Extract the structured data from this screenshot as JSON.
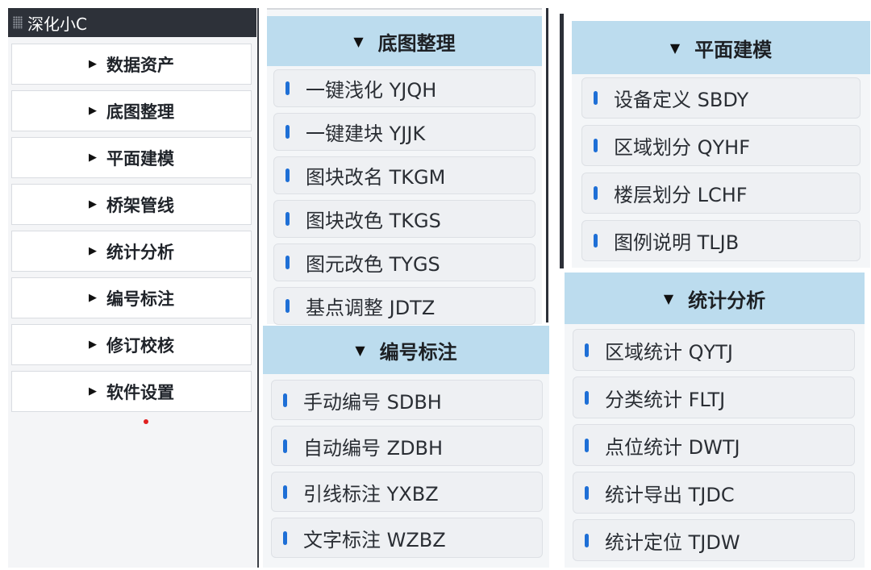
{
  "window": {
    "title": "深化小C"
  },
  "main_menu": [
    {
      "label": "数据资产"
    },
    {
      "label": "底图整理"
    },
    {
      "label": "平面建模"
    },
    {
      "label": "桥架管线"
    },
    {
      "label": "统计分析"
    },
    {
      "label": "编号标注"
    },
    {
      "label": "修订校核"
    },
    {
      "label": "软件设置"
    }
  ],
  "panels": {
    "ditu": {
      "title": "底图整理",
      "items": [
        {
          "label": "一键浅化 YJQH"
        },
        {
          "label": "一键建块 YJJK"
        },
        {
          "label": "图块改名 TKGM"
        },
        {
          "label": "图块改色 TKGS"
        },
        {
          "label": "图元改色 TYGS"
        },
        {
          "label": "基点调整 JDTZ"
        }
      ]
    },
    "pingmian": {
      "title": "平面建模",
      "items": [
        {
          "label": "设备定义 SBDY"
        },
        {
          "label": "区域划分 QYHF"
        },
        {
          "label": "楼层划分 LCHF"
        },
        {
          "label": "图例说明 TLJB"
        }
      ]
    },
    "bianhao": {
      "title": "编号标注",
      "items": [
        {
          "label": "手动编号 SDBH"
        },
        {
          "label": "自动编号 ZDBH"
        },
        {
          "label": "引线标注 YXBZ"
        },
        {
          "label": "文字标注 WZBZ"
        }
      ]
    },
    "tongji": {
      "title": "统计分析",
      "items": [
        {
          "label": "区域统计 QYTJ"
        },
        {
          "label": "分类统计 FLTJ"
        },
        {
          "label": "点位统计 DWTJ"
        },
        {
          "label": "统计导出 TJDC"
        },
        {
          "label": "统计定位 TJDW"
        }
      ]
    }
  },
  "colors": {
    "titlebar_bg": "#2d3139",
    "panel_header_bg": "#bcdcee",
    "marker_blue": "#1e6fd6"
  }
}
